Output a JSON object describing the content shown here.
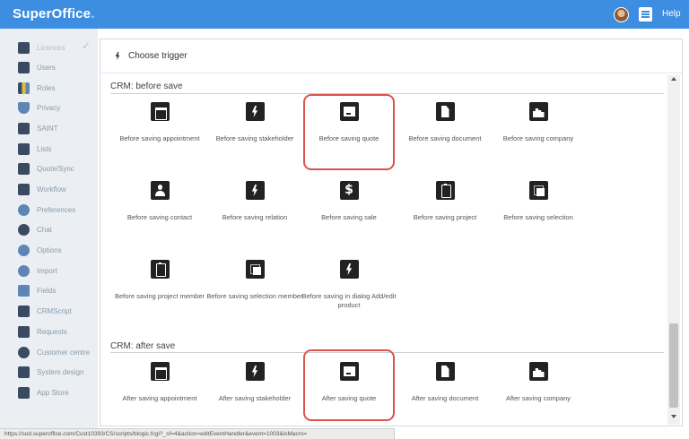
{
  "app": {
    "logo_text": "SuperOffice",
    "logo_dot": ".",
    "help_label": "Help",
    "accent_color": "#3d8ee0"
  },
  "sidebar": {
    "items": [
      {
        "label": "Licences",
        "icon": "lock-icon",
        "active": true
      },
      {
        "label": "Users",
        "icon": "user-icon"
      },
      {
        "label": "Roles",
        "icon": "roles-icon"
      },
      {
        "label": "Privacy",
        "icon": "shield-icon"
      },
      {
        "label": "SAINT",
        "icon": "bar-chart-icon"
      },
      {
        "label": "Lists",
        "icon": "list-icon"
      },
      {
        "label": "Quote/Sync",
        "icon": "barcode-icon"
      },
      {
        "label": "Workflow",
        "icon": "signpost-icon"
      },
      {
        "label": "Preferences",
        "icon": "gear-icon"
      },
      {
        "label": "Chat",
        "icon": "chat-bubble-icon"
      },
      {
        "label": "Options",
        "icon": "gear-icon"
      },
      {
        "label": "Import",
        "icon": "import-icon"
      },
      {
        "label": "Fields",
        "icon": "fields-icon"
      },
      {
        "label": "CRMScript",
        "icon": "script-icon"
      },
      {
        "label": "Requests",
        "icon": "pencil-icon"
      },
      {
        "label": "Customer centre",
        "icon": "globe-icon"
      },
      {
        "label": "System design",
        "icon": "window-icon"
      },
      {
        "label": "App Store",
        "icon": "letter-a-icon"
      }
    ]
  },
  "main": {
    "header": "Choose trigger",
    "sections": [
      {
        "title": "CRM: before save",
        "tiles": [
          {
            "label": "Before saving appointment",
            "icon": "calendar-icon"
          },
          {
            "label": "Before saving stakeholder",
            "icon": "bolt-icon"
          },
          {
            "label": "Before saving quote",
            "icon": "quote-icon",
            "highlighted": true
          },
          {
            "label": "Before saving document",
            "icon": "document-icon"
          },
          {
            "label": "Before saving company",
            "icon": "company-icon"
          },
          {
            "label": "Before saving contact",
            "icon": "person-icon"
          },
          {
            "label": "Before saving relation",
            "icon": "bolt-icon"
          },
          {
            "label": "Before saving sale",
            "icon": "dollar-icon"
          },
          {
            "label": "Before saving project",
            "icon": "clipboard-icon"
          },
          {
            "label": "Before saving selection",
            "icon": "selection-icon"
          },
          {
            "label": "Before saving project member",
            "icon": "clipboard-icon"
          },
          {
            "label": "Before saving selection member",
            "icon": "selection-icon"
          },
          {
            "label": "Before saving in dialog Add/edit product",
            "icon": "bolt-icon"
          }
        ]
      },
      {
        "title": "CRM: after save",
        "tiles": [
          {
            "label": "After saving appointment",
            "icon": "calendar-icon"
          },
          {
            "label": "After saving stakeholder",
            "icon": "bolt-icon"
          },
          {
            "label": "After saving quote",
            "icon": "quote-icon",
            "highlighted": true
          },
          {
            "label": "After saving document",
            "icon": "document-icon"
          },
          {
            "label": "After saving company",
            "icon": "company-icon"
          }
        ]
      }
    ]
  },
  "status_bar": {
    "url": "https://sod.superoffice.com/Cust10393/CS/scripts/blogic.fcgi?_sf=4&action=editEventHandler&event=1003&isMacro="
  },
  "highlight_color": "#d9534f"
}
